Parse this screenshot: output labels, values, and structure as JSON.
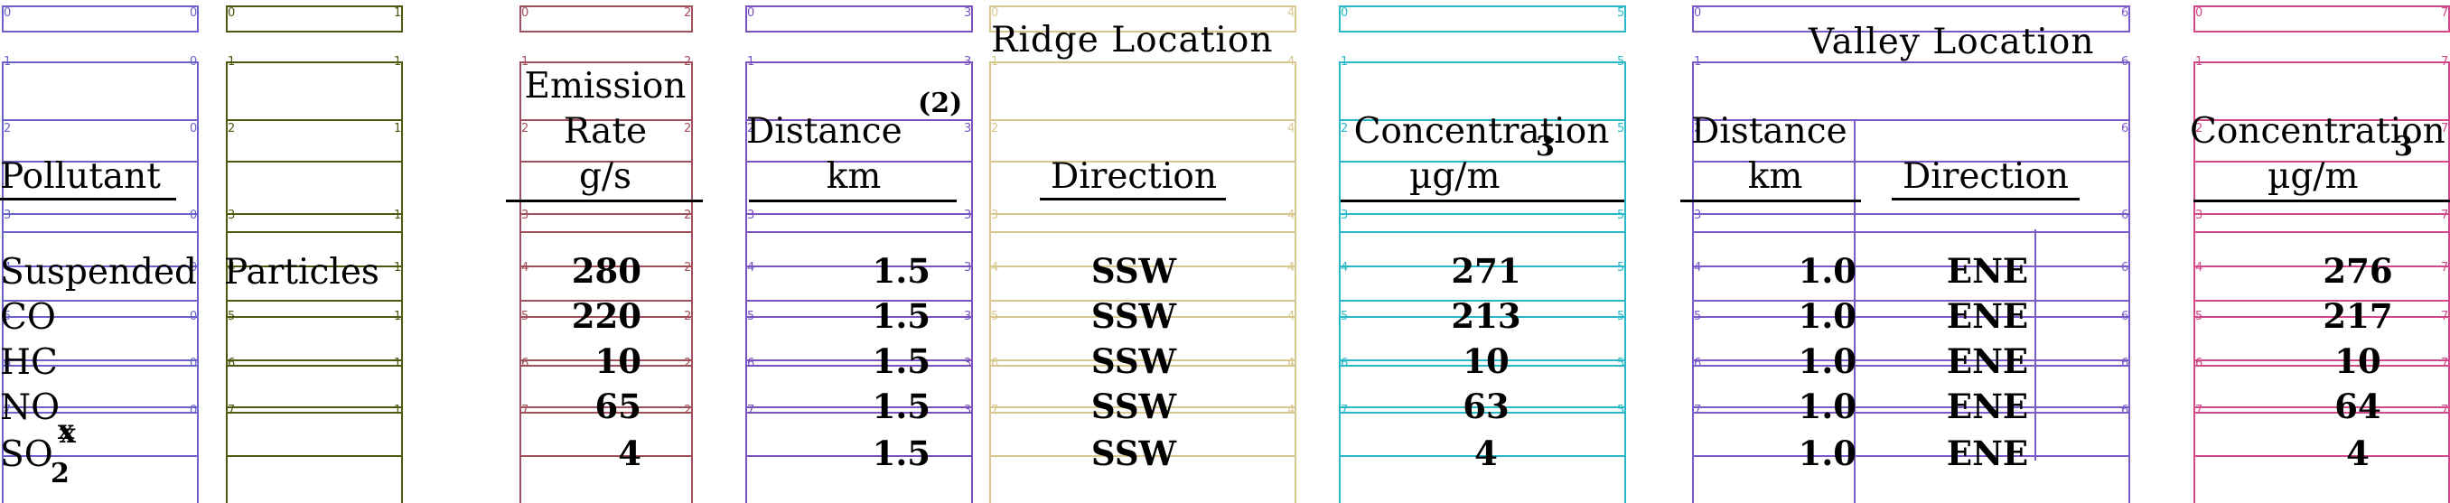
{
  "headers": {
    "ridge_location": "Ridge Location",
    "valley_location": "Valley Location",
    "pollutant": "Pollutant",
    "emission_rate_1": "Emission",
    "emission_rate_2": "Rate",
    "emission_rate_unit": "g/s",
    "distance": "Distance",
    "distance_note": "(2)",
    "distance_unit": "km",
    "direction": "Direction",
    "concentration": "Concentration",
    "concentration_unit": "µg/m",
    "concentration_unit_sup": "3"
  },
  "rows": [
    {
      "pollutant": "Suspended",
      "pollutant_cont": "Particles",
      "rate": "280",
      "ridge_dist": "1.5",
      "ridge_dir": "SSW",
      "ridge_conc": "271",
      "valley_dist": "1.0",
      "valley_dir": "ENE",
      "valley_conc": "276"
    },
    {
      "pollutant": "CO",
      "rate": "220",
      "ridge_dist": "1.5",
      "ridge_dir": "SSW",
      "ridge_conc": "213",
      "valley_dist": "1.0",
      "valley_dir": "ENE",
      "valley_conc": "217"
    },
    {
      "pollutant": "HC",
      "rate": "10",
      "ridge_dist": "1.5",
      "ridge_dir": "SSW",
      "ridge_conc": "10",
      "valley_dist": "1.0",
      "valley_dir": "ENE",
      "valley_conc": "10"
    },
    {
      "pollutant": "NO",
      "pollutant_sub": "x",
      "rate": "65",
      "ridge_dist": "1.5",
      "ridge_dir": "SSW",
      "ridge_conc": "63",
      "valley_dist": "1.0",
      "valley_dir": "ENE",
      "valley_conc": "64"
    },
    {
      "pollutant": "SO",
      "pollutant_sub2": "2",
      "pollutant_sup": "x",
      "rate": "4",
      "ridge_dist": "1.5",
      "ridge_dir": "SSW",
      "ridge_conc": "4",
      "valley_dist": "1.0",
      "valley_dir": "ENE",
      "valley_conc": "4"
    }
  ],
  "overlay": {
    "colors": {
      "c0": "#6a62c8",
      "c1": "#4a5a10",
      "c2": "#a0505a",
      "c3": "#7a52c0",
      "c4": "#d8c890",
      "c5": "#28b8c8",
      "c6": "#7a5ac8",
      "c7": "#d04888"
    }
  }
}
